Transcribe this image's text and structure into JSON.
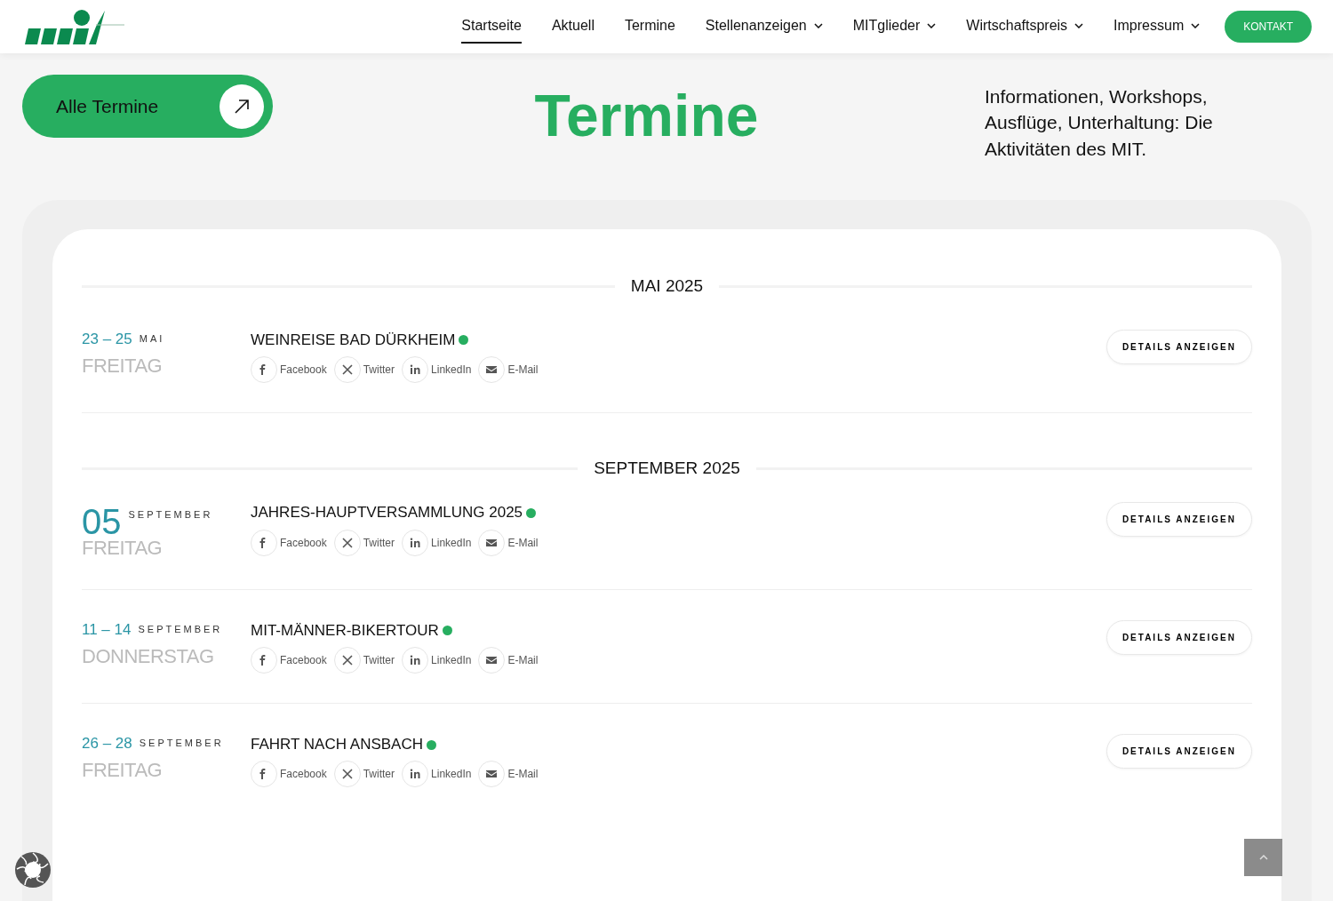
{
  "nav": {
    "items": [
      {
        "label": "Startseite",
        "selected": true,
        "dropdown": false
      },
      {
        "label": "Aktuell",
        "selected": false,
        "dropdown": false
      },
      {
        "label": "Termine",
        "selected": false,
        "dropdown": false
      },
      {
        "label": "Stellenanzeigen",
        "selected": false,
        "dropdown": true
      },
      {
        "label": "MITglieder",
        "selected": false,
        "dropdown": true
      },
      {
        "label": "Wirtschaftspreis",
        "selected": false,
        "dropdown": true
      },
      {
        "label": "Impressum",
        "selected": false,
        "dropdown": true
      }
    ],
    "contact": "KONTAKT"
  },
  "hero": {
    "button": "Alle Termine",
    "title": "Termine",
    "intro": "Informationen, Workshops, Ausflüge, Unterhaltung: Die Aktivitäten des MIT."
  },
  "months": [
    {
      "heading": "MAI 2025",
      "events": [
        {
          "kind": "range",
          "days": "23 – 25",
          "month": "MAI",
          "weekday": "FREITAG",
          "title": "WEINREISE BAD DÜRKHEIM",
          "details": "DETAILS ANZEIGEN",
          "shares": [
            {
              "kind": "facebook",
              "label": "Facebook"
            },
            {
              "kind": "x",
              "label": "Twitter"
            },
            {
              "kind": "linkedin",
              "label": "LinkedIn"
            },
            {
              "kind": "email",
              "label": "E-Mail"
            }
          ]
        }
      ]
    },
    {
      "heading": "SEPTEMBER 2025",
      "events": [
        {
          "kind": "single",
          "days": "05",
          "month": "SEPTEMBER",
          "weekday": "FREITAG",
          "title": "JAHRES-HAUPTVERSAMMLUNG 2025",
          "details": "DETAILS ANZEIGEN",
          "shares": [
            {
              "kind": "facebook",
              "label": "Facebook"
            },
            {
              "kind": "x",
              "label": "Twitter"
            },
            {
              "kind": "linkedin",
              "label": "LinkedIn"
            },
            {
              "kind": "email",
              "label": "E-Mail"
            }
          ]
        },
        {
          "kind": "range",
          "days": "11 – 14",
          "month": "SEPTEMBER",
          "weekday": "DONNERSTAG",
          "title": "MIT-MÄNNER-BIKERTOUR",
          "details": "DETAILS ANZEIGEN",
          "shares": [
            {
              "kind": "facebook",
              "label": "Facebook"
            },
            {
              "kind": "x",
              "label": "Twitter"
            },
            {
              "kind": "linkedin",
              "label": "LinkedIn"
            },
            {
              "kind": "email",
              "label": "E-Mail"
            }
          ]
        },
        {
          "kind": "range",
          "days": "26 – 28",
          "month": "SEPTEMBER",
          "weekday": "FREITAG",
          "title": "FAHRT NACH ANSBACH",
          "details": "DETAILS ANZEIGEN",
          "shares": [
            {
              "kind": "facebook",
              "label": "Facebook"
            },
            {
              "kind": "x",
              "label": "Twitter"
            },
            {
              "kind": "linkedin",
              "label": "LinkedIn"
            },
            {
              "kind": "email",
              "label": "E-Mail"
            }
          ]
        }
      ]
    }
  ]
}
